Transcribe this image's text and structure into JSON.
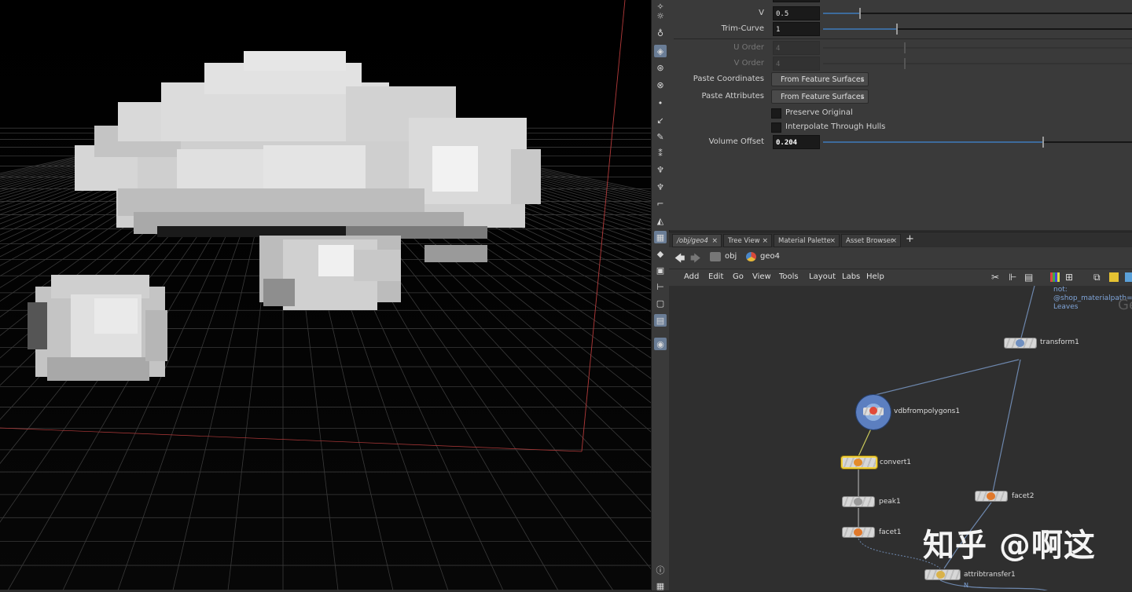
{
  "parameters": {
    "v": {
      "label": "V",
      "value": "0.5",
      "slider": 0.12
    },
    "trim_curve": {
      "label": "Trim-Curve",
      "value": "1",
      "slider": 0.24
    },
    "u_order": {
      "label": "U Order",
      "value": "4"
    },
    "v_order": {
      "label": "V Order",
      "value": "4"
    },
    "paste_coordinates": {
      "label": "Paste Coordinates",
      "value": "From Feature Surfaces"
    },
    "paste_attributes": {
      "label": "Paste Attributes",
      "value": "From Feature Surfaces"
    },
    "preserve_original": {
      "label": "Preserve Original",
      "checked": false
    },
    "interpolate_through_hulls": {
      "label": "Interpolate Through Hulls",
      "checked": false
    },
    "volume_offset": {
      "label": "Volume Offset",
      "value": "0.204",
      "slider": 0.71
    }
  },
  "tabs": [
    {
      "label": "/obj/geo4",
      "close": "×"
    },
    {
      "label": "Tree View",
      "close": "×"
    },
    {
      "label": "Material Palette",
      "close": "×"
    },
    {
      "label": "Asset Browser",
      "close": "×"
    }
  ],
  "add_tab_label": "+",
  "path": {
    "root": "obj",
    "current": "geo4"
  },
  "menu": [
    "Add",
    "Edit",
    "Go",
    "View",
    "Tools",
    "Layout",
    "Labs",
    "Help"
  ],
  "network": {
    "note_lines": [
      "not:",
      "@shop_materialpath=Mi_Re",
      "Leaves"
    ],
    "corner_text": "Ge",
    "nodes": {
      "transform": "transform1",
      "vdb": "vdbfrompolygons1",
      "convert": "convert1",
      "peak": "peak1",
      "facet1": "facet1",
      "facet2": "facet2",
      "attribtransfer": "attribtransfer1"
    },
    "wire_label": "N"
  },
  "watermark": "知乎 @啊这",
  "colors": {
    "accent": "#3d6b9c",
    "selection": "#f2d03a",
    "grid": "#3a3a3a",
    "bbox": "#b33a3a"
  }
}
